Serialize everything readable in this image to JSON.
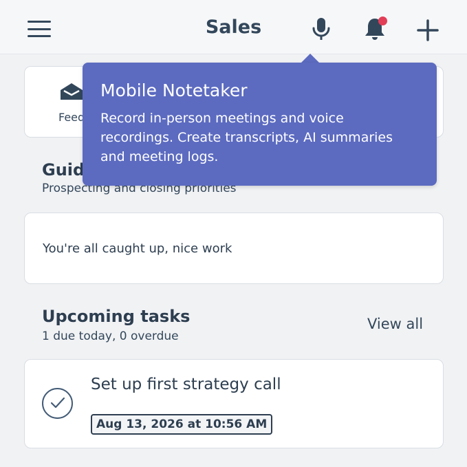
{
  "header": {
    "menu_icon": "hamburger-icon",
    "title": "Sales",
    "mic_icon": "microphone-icon",
    "bell_icon": "bell-icon",
    "add_icon": "plus-icon",
    "notification_dot_color": "#e23e57"
  },
  "feed": {
    "icon": "inbox-icon",
    "label": "Feed"
  },
  "guide": {
    "title": "Guide",
    "subtitle": "Prospecting and closing priorities",
    "empty_message": "You're all caught up, nice work"
  },
  "tasks": {
    "title": "Upcoming tasks",
    "subtitle": "1 due today, 0 overdue",
    "view_all": "View all",
    "items": [
      {
        "title": "Set up first strategy call",
        "due": "Aug 13, 2026 at 10:56 AM",
        "icon": "check-circle-icon"
      }
    ]
  },
  "tooltip": {
    "title": "Mobile Notetaker",
    "body": "Record in-person meetings and voice recordings. Create transcripts, AI summaries and meeting logs.",
    "color": "#5c6bc0"
  }
}
